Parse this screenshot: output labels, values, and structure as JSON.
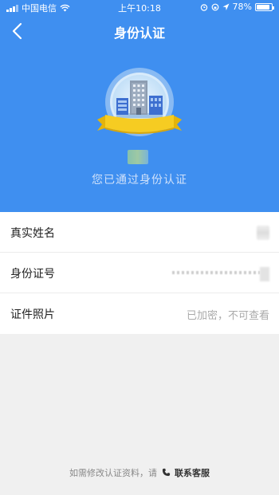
{
  "status_bar": {
    "carrier": "中国电信",
    "time": "上午10:18",
    "battery": "78%"
  },
  "nav": {
    "title": "身份认证"
  },
  "header": {
    "verified_text": "您已通过身份认证"
  },
  "fields": [
    {
      "label": "真实姓名"
    },
    {
      "label": "身份证号"
    },
    {
      "label": "证件照片",
      "value": "已加密，不可查看"
    }
  ],
  "footer": {
    "prefix": "如需修改认证资料，请",
    "contact": "联系客服"
  },
  "colors": {
    "header_bg": "#3f8ff0",
    "page_bg": "#f0f0f0"
  }
}
